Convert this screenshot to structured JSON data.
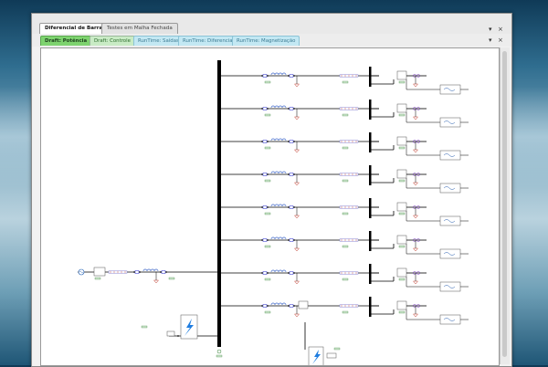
{
  "tabs": {
    "documents": [
      {
        "label": "Diferencial de Barra",
        "active": true
      },
      {
        "label": "Testes em Malha Fechada",
        "active": false
      }
    ],
    "views": [
      {
        "label": "Draft: Potência",
        "active": true,
        "kind": "draft"
      },
      {
        "label": "Draft: Controle",
        "active": false,
        "kind": "draft"
      },
      {
        "label": "RunTime: Saídas",
        "active": false,
        "kind": "runtime"
      },
      {
        "label": "RunTime: Diferencial",
        "active": false,
        "kind": "runtime"
      },
      {
        "label": "RunTime: Magnetização",
        "active": false,
        "kind": "runtime"
      }
    ]
  },
  "window_controls": {
    "dropdown_glyph": "▾",
    "close_glyph": "×"
  },
  "diagram": {
    "feeder_count": 8,
    "colors": {
      "wire": "#000000",
      "busbar": "#000000",
      "breaker": "#4a4fd6",
      "inductor": "#3d66c8",
      "ct": "#c0392b",
      "label": "#2c7a2c",
      "fault": "#1f7de0"
    },
    "icons": [
      "ac-source-icon",
      "transformer-icon",
      "breaker-icon",
      "inductor-icon",
      "ground-icon",
      "load-icon",
      "fault-icon"
    ]
  },
  "background": {
    "accent": "#2f6d8f"
  }
}
